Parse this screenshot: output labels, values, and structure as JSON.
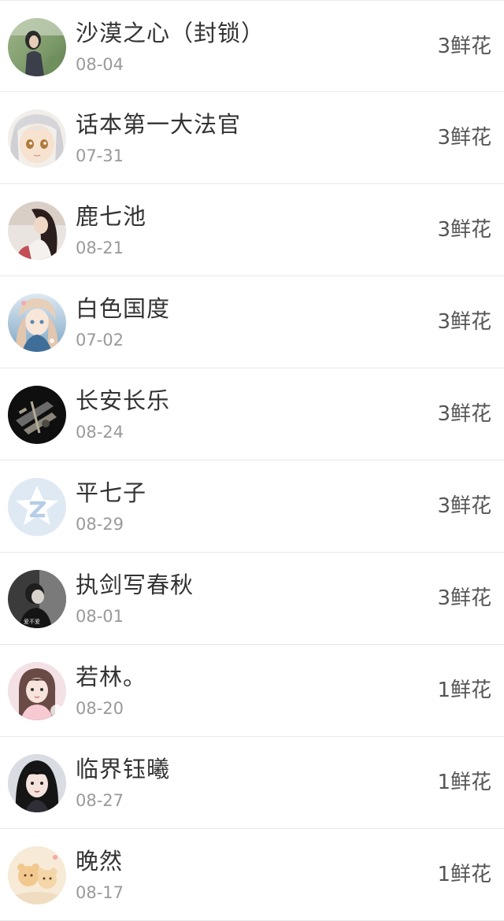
{
  "users": [
    {
      "name": "沙漠之心（封锁）",
      "date": "08-04",
      "flowers": "3鲜花",
      "avatar": "avatar-landscape-girl-icon"
    },
    {
      "name": "话本第一大法官",
      "date": "07-31",
      "flowers": "3鲜花",
      "avatar": "avatar-anime-silver-hair-icon"
    },
    {
      "name": "鹿七池",
      "date": "08-21",
      "flowers": "3鲜花",
      "avatar": "avatar-dark-hair-girl-icon"
    },
    {
      "name": "白色国度",
      "date": "07-02",
      "flowers": "3鲜花",
      "avatar": "avatar-anime-blue-girl-icon"
    },
    {
      "name": "长安长乐",
      "date": "08-24",
      "flowers": "3鲜花",
      "avatar": "avatar-dark-objects-icon"
    },
    {
      "name": "平七子",
      "date": "08-29",
      "flowers": "3鲜花",
      "avatar": "avatar-default-qzone-star-icon"
    },
    {
      "name": "执剑写春秋",
      "date": "08-01",
      "flowers": "3鲜花",
      "avatar": "avatar-grey-photo-icon",
      "avatar_caption": "爱不爱"
    },
    {
      "name": "若林。",
      "date": "08-20",
      "flowers": "1鲜花",
      "avatar": "avatar-pink-girl-icon"
    },
    {
      "name": "临界钰曦",
      "date": "08-27",
      "flowers": "1鲜花",
      "avatar": "avatar-dark-hair-portrait-icon"
    },
    {
      "name": "晚然",
      "date": "08-17",
      "flowers": "1鲜花",
      "avatar": "avatar-cartoon-bears-icon"
    }
  ]
}
